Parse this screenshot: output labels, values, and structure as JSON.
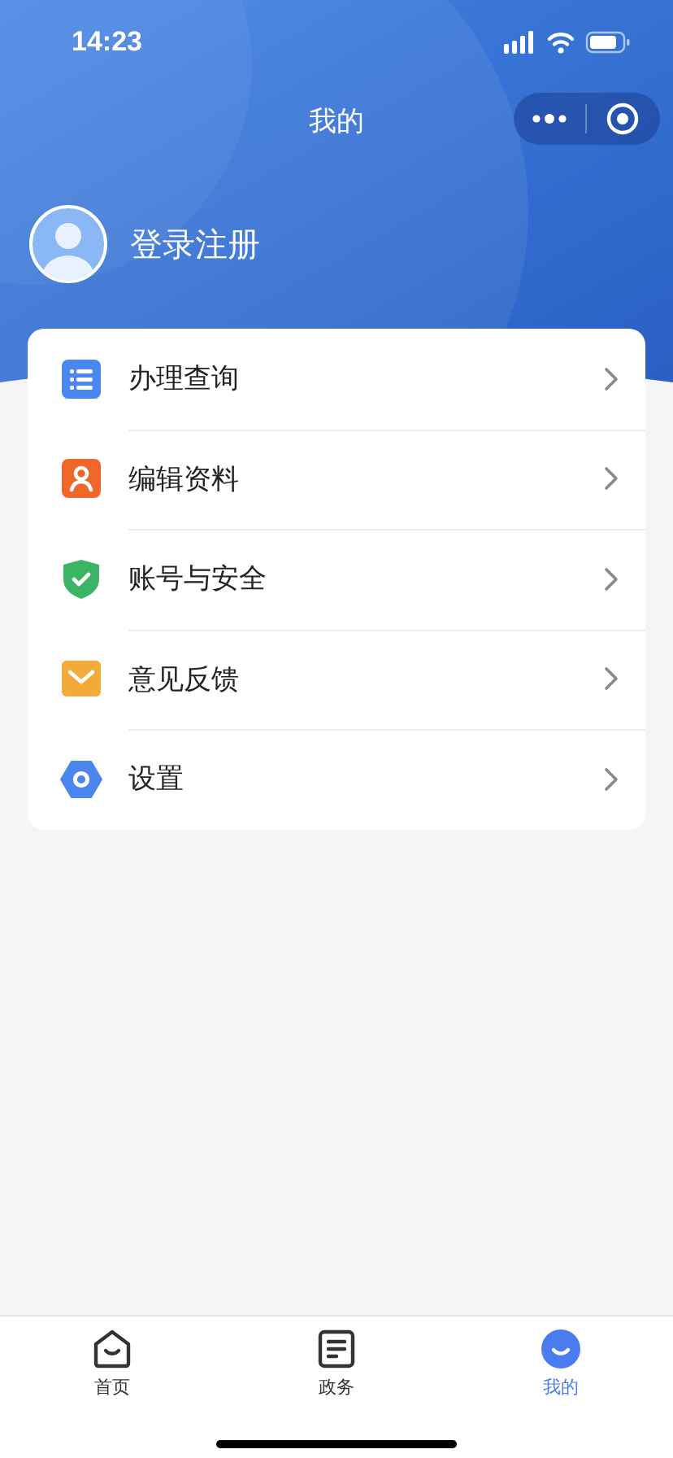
{
  "status_bar": {
    "time": "14:23"
  },
  "nav": {
    "title": "我的"
  },
  "profile": {
    "name": "登录注册"
  },
  "menu": [
    {
      "kind": "list",
      "label": "办理查询"
    },
    {
      "kind": "person",
      "label": "编辑资料"
    },
    {
      "kind": "shield",
      "label": "账号与安全"
    },
    {
      "kind": "mail",
      "label": "意见反馈"
    },
    {
      "kind": "gear",
      "label": "设置"
    }
  ],
  "tabs": [
    {
      "kind": "home",
      "label": "首页",
      "selected": false
    },
    {
      "kind": "document",
      "label": "政务",
      "selected": false
    },
    {
      "kind": "profile",
      "label": "我的",
      "selected": true
    }
  ]
}
